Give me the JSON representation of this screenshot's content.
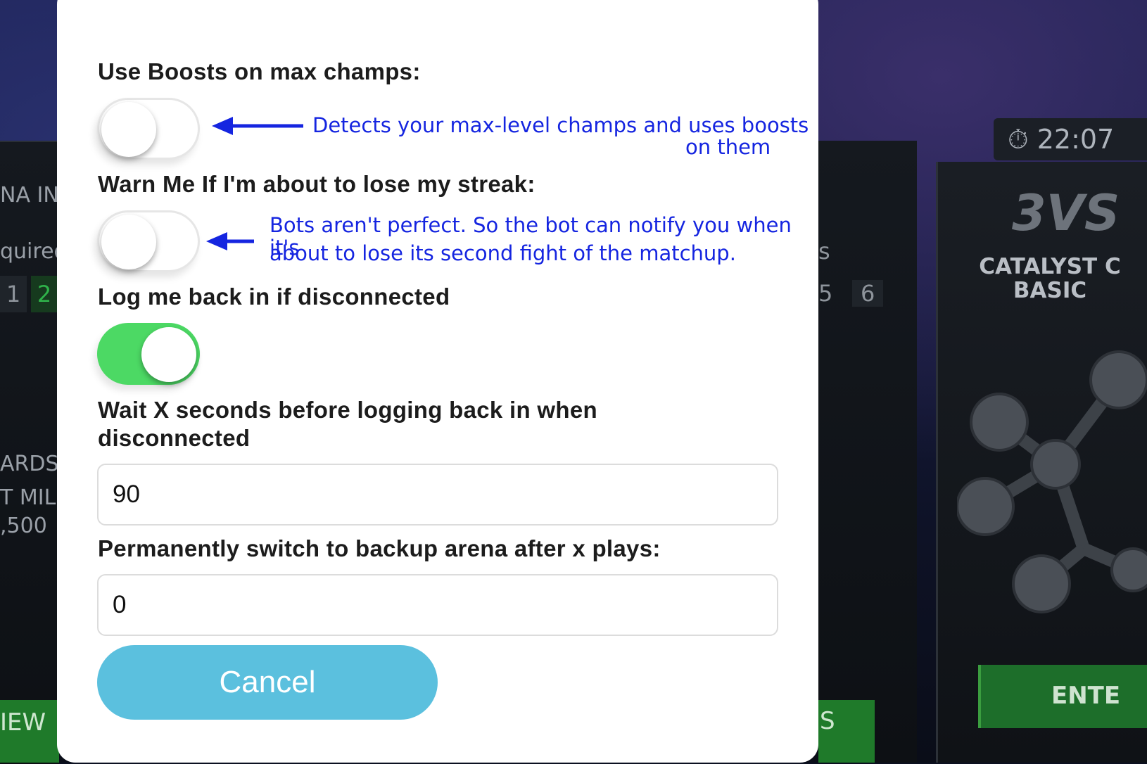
{
  "background": {
    "left_texts": [
      "NA IN",
      "quired",
      "ARDS",
      "T MIL",
      ",500",
      "IEW"
    ],
    "left_chips": [
      "1",
      "2"
    ],
    "right_texts": [
      "s",
      "5",
      "6",
      "S"
    ],
    "timer": "22:07",
    "mode": "3VS",
    "catalyst": "CATALYST C\nBASIC",
    "enter": "ENTE"
  },
  "modal": {
    "boosts": {
      "label": "Use Boosts on max champs:",
      "on": false,
      "annotation_line1": "Detects your max-level champs and uses boosts",
      "annotation_line2": "on them"
    },
    "warn": {
      "label": "Warn Me If I'm about to lose my streak:",
      "on": false,
      "annotation_line1": "Bots aren't perfect.  So the bot can notify you when it's",
      "annotation_line2": "about to lose its second fight of the matchup."
    },
    "relog": {
      "label": "Log me back in if disconnected",
      "on": true
    },
    "wait": {
      "label_line1": "Wait X seconds before logging back in when",
      "label_line2": "disconnected",
      "value": "90"
    },
    "backup": {
      "label": "Permanently switch to backup arena after x plays:",
      "value": "0"
    },
    "cancel_label": "Cancel"
  },
  "colors": {
    "toggle_on": "#4cd964",
    "annotation": "#1525e0",
    "cancel": "#5bc0de"
  }
}
